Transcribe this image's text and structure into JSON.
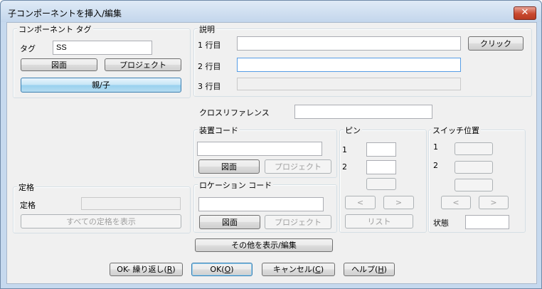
{
  "window": {
    "title": "子コンポーネントを挿入/編集",
    "close_icon": "close-icon"
  },
  "component_tag": {
    "group_label": "コンポーネント タグ",
    "tag_label": "タグ",
    "tag_value": "SS",
    "drawing_button": "図面",
    "project_button": "プロジェクト",
    "parent_child_button": "親/子"
  },
  "description": {
    "group_label": "説明",
    "line1_label": "1 行目",
    "line2_label": "2 行目",
    "line3_label": "3 行目",
    "line1_value": "",
    "line2_value": "",
    "line3_value": "",
    "click_button": "クリック"
  },
  "cross_reference": {
    "label": "クロスリファレンス",
    "value": ""
  },
  "installation_code": {
    "group_label": "装置コード",
    "value": "",
    "drawing_button": "図面",
    "project_button": "プロジェクト"
  },
  "location_code": {
    "group_label": "ロケーション コード",
    "value": "",
    "drawing_button": "図面",
    "project_button": "プロジェクト"
  },
  "rating": {
    "group_label": "定格",
    "rating_label": "定格",
    "value": "",
    "show_all_button": "すべての定格を表示"
  },
  "pin": {
    "group_label": "ピン",
    "pin1_label": "1",
    "pin2_label": "2",
    "pin1_value": "",
    "pin2_value": "",
    "prev_button": "<",
    "next_button": ">",
    "list_button": "リスト"
  },
  "switch_position": {
    "group_label": "スイッチ位置",
    "pos1_label": "1",
    "pos2_label": "2",
    "prev_button": "<",
    "next_button": ">",
    "state_label": "状態",
    "state_value": ""
  },
  "show_edit_others_button": "その他を表示/編集",
  "footer": {
    "ok_repeat": {
      "text": "OK- 繰り返し(",
      "key": "R",
      "end": ")"
    },
    "ok": {
      "text": "OK(",
      "key": "O",
      "end": ")"
    },
    "cancel": {
      "text": "キャンセル(",
      "key": "C",
      "end": ")"
    },
    "help": {
      "text": "ヘルプ(",
      "key": "H",
      "end": ")"
    }
  }
}
